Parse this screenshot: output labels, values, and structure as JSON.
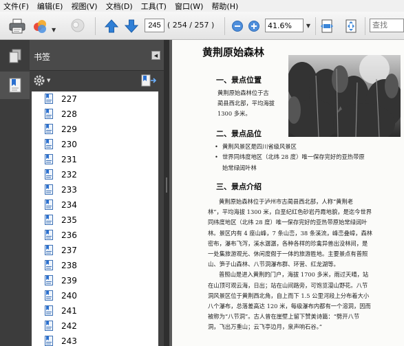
{
  "menu": [
    "文件(F)",
    "编辑(E)",
    "视图(V)",
    "文档(D)",
    "工具(T)",
    "窗口(W)",
    "帮助(H)"
  ],
  "toolbar": {
    "current_page": "245",
    "page_count": "( 254 / 257 )",
    "zoom": "41.6%",
    "search_placeholder": "查找"
  },
  "bookmarks": {
    "title": "书签",
    "items": [
      "227",
      "228",
      "229",
      "230",
      "231",
      "232",
      "233",
      "234",
      "235",
      "236",
      "237",
      "238",
      "239",
      "240",
      "241",
      "242",
      "243"
    ]
  },
  "document": {
    "title": "黄荆原始森林",
    "section1": "一、景点位置",
    "section1_text": [
      "黄荆原始森林位于古",
      "蔺县西北部，平均海拔",
      "1300 多米。"
    ],
    "section2": "二、景点品位",
    "bullets": [
      "黄荆风景区是四川省级风景区",
      "世界同纬度地区（北纬 28 度）唯一保存完好的亚热带原",
      "始常绿阔叶林"
    ],
    "section3": "三、景点介绍",
    "body": [
      "黄荆原始森林位于泸州市古蔺县西北部，人称“黄荆老",
      "林”，平均海拔 1300 米，白垩纪红色砂岩丹霞地貌，是迄今世界",
      "同纬度地区（北纬 28 度）唯一保存完好的亚热带原始常绿阔叶",
      "林。景区内有 4 座山峰，7 条山峦，38 条溪流，峰峦叠嶂，森林",
      "密布，瀑布飞泻，溪水潺潺，各种各样的珍禽异兽出没林间，是",
      "一处集旅游观光、休闲度假于一体的旅游胜地。主要景点有普照",
      "山、笋子山森林、八节洞瀑布群、环营、红龙湖等。",
      "普照山是进入黄荆的门户，海拔 1700 多米，雨过天晴，站",
      "在山顶可观云海，日出；站在山间路旁，可饱览漫山野花。八节",
      "洞风景区位于黄荆西北角，自上而下 1.5 公里河段上分布着大小",
      "八个瀑布，总落差高达 120 米，每级瀑布内都有一个溶洞，因而",
      "被称为“八节洞”。古人曾在崖壁上留下赞美诗篇：“劈开八节",
      "洞，飞出万重山；云飞亭边月，泉声响石谷。”"
    ]
  }
}
